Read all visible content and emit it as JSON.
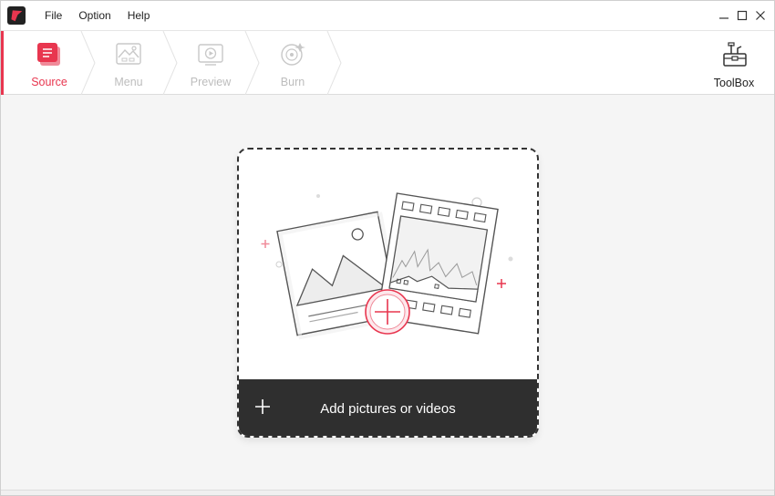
{
  "titlebar": {
    "menu": [
      "File",
      "Option",
      "Help"
    ],
    "controls": [
      "minimize-icon",
      "maximize-icon",
      "close-icon"
    ]
  },
  "steps": [
    {
      "label": "Source",
      "icon": "source-icon",
      "state": "active"
    },
    {
      "label": "Menu",
      "icon": "menu-template-icon",
      "state": "disabled"
    },
    {
      "label": "Preview",
      "icon": "preview-icon",
      "state": "disabled"
    },
    {
      "label": "Burn",
      "icon": "burn-disc-icon",
      "state": "disabled"
    }
  ],
  "toolbox": {
    "label": "ToolBox",
    "icon": "toolbox-icon"
  },
  "dropzone": {
    "action_label": "Add pictures or videos",
    "icons": [
      "add-plus-icon",
      "picture-video-illustration",
      "add-circle-icon"
    ]
  },
  "colors": {
    "accent": "#e8364f",
    "dark_bar": "#2f2f2f",
    "disabled": "#bdbdbd"
  }
}
